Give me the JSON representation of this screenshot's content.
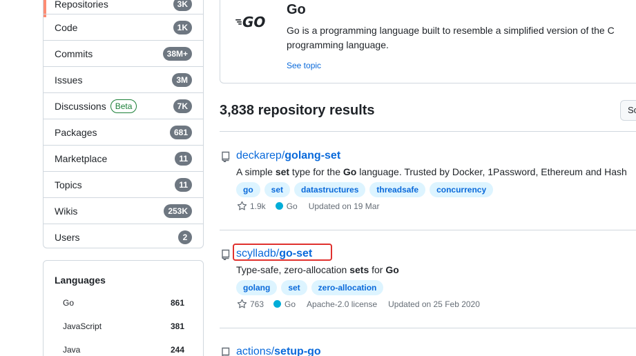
{
  "sidebar": {
    "types": [
      {
        "label": "Repositories",
        "count": "3K",
        "selected": true
      },
      {
        "label": "Code",
        "count": "1K"
      },
      {
        "label": "Commits",
        "count": "38M+"
      },
      {
        "label": "Issues",
        "count": "3M"
      },
      {
        "label": "Discussions",
        "count": "7K",
        "badge": "Beta"
      },
      {
        "label": "Packages",
        "count": "681"
      },
      {
        "label": "Marketplace",
        "count": "11"
      },
      {
        "label": "Topics",
        "count": "11"
      },
      {
        "label": "Wikis",
        "count": "253K"
      },
      {
        "label": "Users",
        "count": "2"
      }
    ],
    "languages": {
      "title": "Languages",
      "items": [
        {
          "label": "Go",
          "count": "861"
        },
        {
          "label": "JavaScript",
          "count": "381"
        },
        {
          "label": "Java",
          "count": "244"
        }
      ]
    }
  },
  "topic": {
    "logo_icon": "go-logo-icon",
    "title": "Go",
    "description": "Go is a programming language built to resemble a simplified version of the C programming language.",
    "link": "See topic"
  },
  "results": {
    "count_label": "3,838 repository results",
    "sort_label": "Sort",
    "items": [
      {
        "owner": "deckarep/",
        "name": "golang-set",
        "description_parts": [
          "A simple ",
          "set",
          " type for the ",
          "Go",
          " language. Trusted by Docker, 1Password, Ethereum and Hash"
        ],
        "topics": [
          "go",
          "set",
          "datastructures",
          "threadsafe",
          "concurrency"
        ],
        "stars": "1.9k",
        "language": "Go",
        "updated": "Updated on 19 Mar"
      },
      {
        "owner": "scylladb/",
        "name": "go-set",
        "description_parts": [
          "Type-safe, zero-allocation ",
          "sets",
          " for ",
          "Go"
        ],
        "topics": [
          "golang",
          "set",
          "zero-allocation"
        ],
        "stars": "763",
        "language": "Go",
        "license": "Apache-2.0 license",
        "updated": "Updated on 25 Feb 2020"
      },
      {
        "owner": "actions/",
        "name": "setup-go"
      }
    ]
  },
  "colors": {
    "link": "#0969da",
    "go_language": "#00add8",
    "highlight": "#e0302d",
    "selected_marker": "#fd8c73"
  }
}
